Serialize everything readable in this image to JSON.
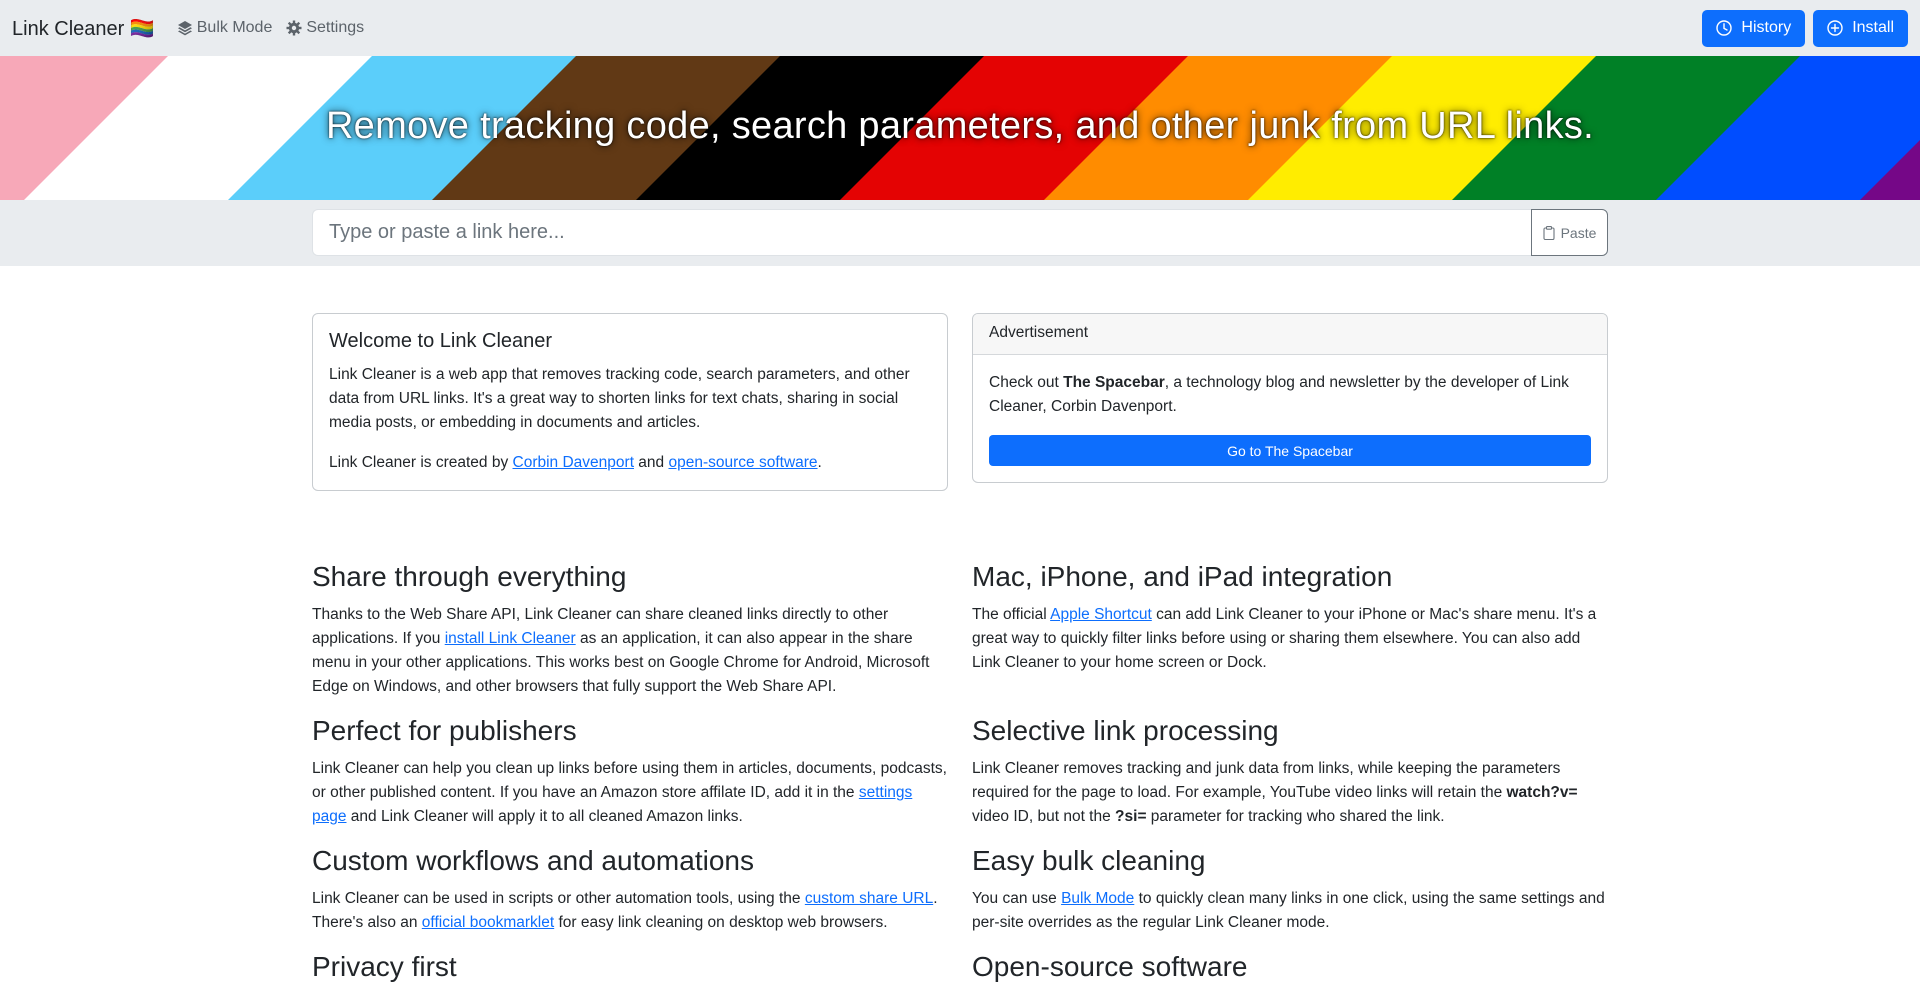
{
  "navbar": {
    "brand": "Link Cleaner 🏳️‍🌈",
    "bulk_mode": "Bulk Mode",
    "settings": "Settings",
    "history": "History",
    "install": "Install"
  },
  "hero": {
    "headline": "Remove tracking code, search parameters, and other junk from URL links."
  },
  "input": {
    "placeholder": "Type or paste a link here...",
    "value": "",
    "paste_label": "Paste"
  },
  "welcome": {
    "title": "Welcome to Link Cleaner",
    "body": "Link Cleaner is a web app that removes tracking code, search parameters, and other data from URL links. It's a great way to shorten links for text chats, sharing in social media posts, or embedding in documents and articles.",
    "created_prefix": "Link Cleaner is created by ",
    "author_link": "Corbin Davenport",
    "and_text": " and ",
    "oss_link": "open-source software",
    "period": "."
  },
  "ad": {
    "header": "Advertisement",
    "prefix": "Check out ",
    "bold": "The Spacebar",
    "suffix": ", a technology blog and newsletter by the developer of Link Cleaner, Corbin Davenport.",
    "button": "Go to The Spacebar"
  },
  "features": {
    "share": {
      "title": "Share through everything",
      "p1": "Thanks to the Web Share API, Link Cleaner can share cleaned links directly to other applications. If you ",
      "link": "install Link Cleaner",
      "p2": " as an application, it can also appear in the share menu in your other applications. This works best on Google Chrome for Android, Microsoft Edge on Windows, and other browsers that fully support the Web Share API."
    },
    "mac": {
      "title": "Mac, iPhone, and iPad integration",
      "p1": "The official ",
      "link": "Apple Shortcut",
      "p2": " can add Link Cleaner to your iPhone or Mac's share menu. It's a great way to quickly filter links before using or sharing them elsewhere. You can also add Link Cleaner to your home screen or Dock."
    },
    "publishers": {
      "title": "Perfect for publishers",
      "p1": "Link Cleaner can help you clean up links before using them in articles, documents, podcasts, or other published content. If you have an Amazon store affilate ID, add it in the ",
      "link": "settings page",
      "p2": " and Link Cleaner will apply it to all cleaned Amazon links."
    },
    "selective": {
      "title": "Selective link processing",
      "p1": "Link Cleaner removes tracking and junk data from links, while keeping the parameters required for the page to load. For example, YouTube video links will retain the ",
      "bold1": "watch?v=",
      "p2": " video ID, but not the ",
      "bold2": "?si=",
      "p3": " parameter for tracking who shared the link."
    },
    "workflows": {
      "title": "Custom workflows and automations",
      "p1": "Link Cleaner can be used in scripts or other automation tools, using the ",
      "link1": "custom share URL",
      "p2": ". There's also an ",
      "link2": "official bookmarklet",
      "p3": " for easy link cleaning on desktop web browsers."
    },
    "bulk": {
      "title": "Easy bulk cleaning",
      "p1": "You can use ",
      "link": "Bulk Mode",
      "p2": " to quickly clean many links in one click, using the same settings and per-site overrides as the regular Link Cleaner mode."
    },
    "privacy": {
      "title": "Privacy first"
    },
    "oss": {
      "title": "Open-source software"
    }
  },
  "colors": {
    "primary": "#0d6efd",
    "navbar_bg": "#e9ecef",
    "flag_stripes": [
      "#f7a8b8",
      "#ffffff",
      "#5bcefa",
      "#613915",
      "#000000",
      "#e40303",
      "#ff8c00",
      "#ffed00",
      "#008026",
      "#004dff",
      "#750787"
    ]
  }
}
